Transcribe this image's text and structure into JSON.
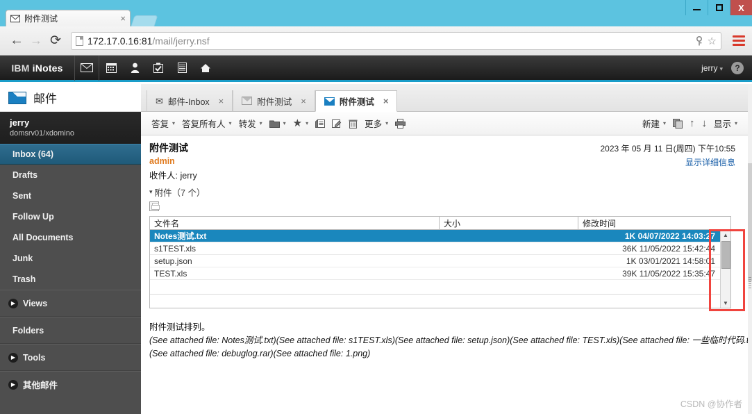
{
  "browser": {
    "tab_title": "附件测试",
    "tab_close": "×",
    "back_icon": "←",
    "forward_icon": "→",
    "reload_icon": "⟳",
    "url_host": "172.17.0.16:81",
    "url_path": "/mail/jerry.nsf",
    "key_icon": "key-icon",
    "bookmark_icon": "☆",
    "menu_icon": "hamburger-menu-icon",
    "window_minimize": "minimize",
    "window_maximize": "maximize",
    "window_close": "X"
  },
  "header": {
    "brand_ibm": "IBM ",
    "brand_inotes": "iNotes",
    "icons": [
      {
        "name": "mail-icon",
        "glyph": "✉"
      },
      {
        "name": "calendar-icon",
        "glyph": "▦"
      },
      {
        "name": "contacts-icon",
        "glyph": "👤"
      },
      {
        "name": "tasks-icon",
        "glyph": "☑"
      },
      {
        "name": "notebook-icon",
        "glyph": "▤"
      },
      {
        "name": "home-icon",
        "glyph": "⌂"
      }
    ],
    "user": "jerry",
    "user_caret": "▾",
    "help": "?"
  },
  "sidebar": {
    "app_title": "邮件",
    "user_name": "jerry",
    "user_org": "domsrv01/xdomino",
    "folders": [
      {
        "label": "Inbox (64)",
        "active": true
      },
      {
        "label": "Drafts",
        "active": false
      },
      {
        "label": "Sent",
        "active": false
      },
      {
        "label": "Follow Up",
        "active": false
      },
      {
        "label": "All Documents",
        "active": false
      },
      {
        "label": "Junk",
        "active": false
      },
      {
        "label": "Trash",
        "active": false
      }
    ],
    "sections": [
      {
        "label": "Views",
        "arrow": "▶"
      },
      {
        "label": "Folders",
        "arrow": ""
      },
      {
        "label": "Tools",
        "arrow": "▶"
      },
      {
        "label": "其他邮件",
        "arrow": "▶"
      }
    ]
  },
  "tabs": [
    {
      "label": "邮件-Inbox",
      "active": false,
      "icon": "envelope-icon",
      "close": "×"
    },
    {
      "label": "附件测试",
      "active": false,
      "icon": "message-icon",
      "close": "×"
    },
    {
      "label": "附件测试",
      "active": true,
      "icon": "message-icon",
      "close": "×"
    }
  ],
  "toolbar": {
    "reply": "答复",
    "reply_all": "答复所有人",
    "forward": "转发",
    "caret": "▾",
    "folder_icon": "folder-icon",
    "flag_icon": "★",
    "markread_icon": "▤",
    "edit_icon": "✎",
    "delete_icon": "🗑",
    "more": "更多",
    "print_icon": "🖶",
    "new": "新建",
    "copy_icon": "❐",
    "up_icon": "↑",
    "down_icon": "↓",
    "display": "显示"
  },
  "message": {
    "subject": "附件测试",
    "from": "admin",
    "to_label": "收件人:",
    "to_value": "jerry",
    "date": "2023 年 05 月 11 日(周四) 下午10:55",
    "details_link": "显示详细信息",
    "attachments_label": "附件（7 个）",
    "attachments_caret": "▾",
    "save_icon": "save-icon",
    "body_line1": "附件测试排列。",
    "body_line2": "(See attached file: Notes测试.txt)(See attached file: s1TEST.xls)(See attached file: setup.json)(See attached file: TEST.xls)(See attached file: 一些临时代码.txt)",
    "body_line3": "(See attached file: debuglog.rar)(See attached file: 1.png)"
  },
  "attachment_grid": {
    "columns": [
      "文件名",
      "大小",
      "修改时间"
    ],
    "rows": [
      {
        "name": "Notes测试.txt",
        "size": "1K",
        "modified": "04/07/2022 14:03:27",
        "selected": true
      },
      {
        "name": "s1TEST.xls",
        "size": "36K",
        "modified": "11/05/2022 15:42:44",
        "selected": false
      },
      {
        "name": "setup.json",
        "size": "1K",
        "modified": "03/01/2021 14:58:01",
        "selected": false
      },
      {
        "name": "TEST.xls",
        "size": "39K",
        "modified": "11/05/2022 15:35:47",
        "selected": false
      }
    ],
    "scroll_up": "▲",
    "scroll_down": "▼"
  },
  "annotation": {
    "highlight_color": "#f0443e"
  },
  "watermark": "CSDN @协作者"
}
